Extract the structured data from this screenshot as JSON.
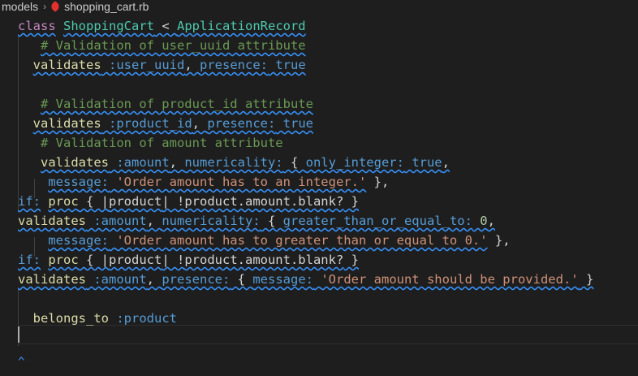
{
  "breadcrumb": {
    "folder": "models",
    "separator": "›",
    "file": "shopping_cart.rb",
    "file_icon": "ruby-icon"
  },
  "colors": {
    "background": "#1e1e1e",
    "keyword": "#c586c0",
    "class_name": "#4ec9b0",
    "comment": "#6a9955",
    "symbol": "#569cd6",
    "string": "#ce9178",
    "number": "#b5cea8",
    "function": "#dcdcaa",
    "warning_squiggle": "#3794ff"
  },
  "code_lines": [
    {
      "indent": "",
      "tokens": [
        [
          "class",
          "kw",
          1
        ],
        [
          " ",
          "plain",
          0
        ],
        [
          "ShoppingCart",
          "cls",
          1
        ],
        [
          " < ",
          "op",
          1
        ],
        [
          "ApplicationRecord",
          "cls",
          1
        ]
      ]
    },
    {
      "indent": "   ",
      "tokens": [
        [
          "# Validation of user_uuid attribute",
          "com",
          1
        ]
      ]
    },
    {
      "indent": "  ",
      "tokens": [
        [
          "validates",
          "fn",
          1
        ],
        [
          " :user_uuid",
          "sym",
          1
        ],
        [
          ", ",
          "op",
          1
        ],
        [
          "presence:",
          "sym",
          1
        ],
        [
          " true",
          "sym",
          1
        ]
      ]
    },
    {
      "indent": "",
      "tokens": []
    },
    {
      "indent": "   ",
      "tokens": [
        [
          "# Validation of product_id attribute",
          "com",
          1
        ]
      ]
    },
    {
      "indent": "  ",
      "tokens": [
        [
          "validates",
          "fn",
          1
        ],
        [
          " :product_id",
          "sym",
          1
        ],
        [
          ", ",
          "op",
          1
        ],
        [
          "presence:",
          "sym",
          1
        ],
        [
          " true",
          "sym",
          1
        ]
      ]
    },
    {
      "indent": "   ",
      "tokens": [
        [
          "# Validation of amount attribute",
          "com",
          0
        ]
      ]
    },
    {
      "indent": "   ",
      "tokens": [
        [
          "validates",
          "fn",
          1
        ],
        [
          " :amount",
          "sym",
          1
        ],
        [
          ", ",
          "op",
          1
        ],
        [
          "numericality:",
          "sym",
          1
        ],
        [
          " { ",
          "op",
          1
        ],
        [
          "only_integer:",
          "sym",
          1
        ],
        [
          " true",
          "sym",
          1
        ],
        [
          ",",
          "op",
          1
        ]
      ]
    },
    {
      "indent": "    ",
      "tokens": [
        [
          "message:",
          "sym",
          1
        ],
        [
          " ",
          "op",
          1
        ],
        [
          "'Order amount has to an integer.'",
          "str",
          1
        ],
        [
          " },",
          "op",
          0
        ]
      ]
    },
    {
      "indent": "",
      "tokens": [
        [
          "if:",
          "sym",
          1
        ],
        [
          " ",
          "op",
          0
        ],
        [
          "proc",
          "fn",
          1
        ],
        [
          " { |",
          "op",
          1
        ],
        [
          "product",
          "plain",
          1
        ],
        [
          "| !",
          "op",
          1
        ],
        [
          "product.amount.blank?",
          "plain",
          1
        ],
        [
          " }",
          "op",
          1
        ]
      ]
    },
    {
      "indent": "",
      "tokens": [
        [
          "validates",
          "fn",
          1
        ],
        [
          " :amount",
          "sym",
          1
        ],
        [
          ", ",
          "op",
          1
        ],
        [
          "numericality:",
          "sym",
          1
        ],
        [
          " { ",
          "op",
          1
        ],
        [
          "greater_than_or_equal_to:",
          "sym",
          1
        ],
        [
          " 0",
          "num",
          1
        ],
        [
          ",",
          "op",
          1
        ]
      ]
    },
    {
      "indent": "    ",
      "tokens": [
        [
          "message:",
          "sym",
          1
        ],
        [
          " ",
          "op",
          1
        ],
        [
          "'Order amount has to greater than or equal to 0.'",
          "str",
          1
        ],
        [
          " },",
          "op",
          0
        ]
      ]
    },
    {
      "indent": "",
      "tokens": [
        [
          "if:",
          "sym",
          1
        ],
        [
          " ",
          "op",
          0
        ],
        [
          "proc",
          "fn",
          1
        ],
        [
          " { |",
          "op",
          1
        ],
        [
          "product",
          "plain",
          1
        ],
        [
          "| !",
          "op",
          1
        ],
        [
          "product.amount.blank?",
          "plain",
          1
        ],
        [
          " }",
          "op",
          1
        ]
      ]
    },
    {
      "indent": "",
      "tokens": [
        [
          "validates",
          "fn",
          1
        ],
        [
          " :amount",
          "sym",
          1
        ],
        [
          ", ",
          "op",
          1
        ],
        [
          "presence:",
          "sym",
          1
        ],
        [
          " { ",
          "op",
          1
        ],
        [
          "message:",
          "sym",
          1
        ],
        [
          " ",
          "op",
          1
        ],
        [
          "'Order amount should be provided.'",
          "str",
          1
        ],
        [
          " }",
          "op",
          1
        ]
      ]
    },
    {
      "indent": "",
      "tokens": []
    },
    {
      "indent": "  ",
      "tokens": [
        [
          "belongs_to",
          "fn",
          0
        ],
        [
          " :product",
          "sym",
          0
        ]
      ]
    },
    {
      "indent": "",
      "tokens": []
    }
  ],
  "fold_marker": "^"
}
